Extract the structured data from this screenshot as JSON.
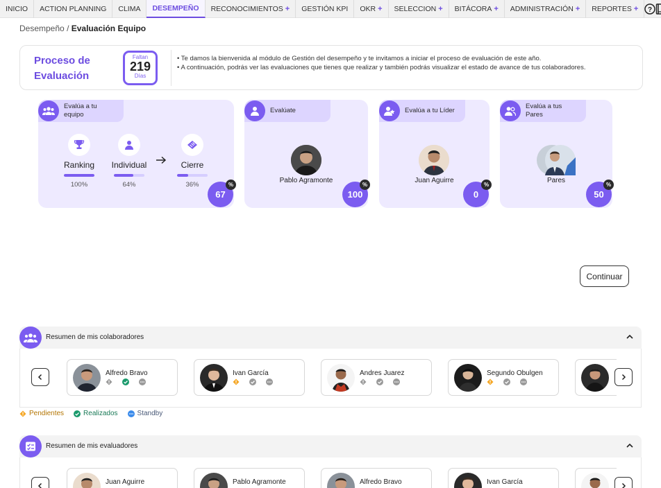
{
  "nav": {
    "items": [
      {
        "label": "INICIO",
        "plus": false,
        "active": false
      },
      {
        "label": "ACTION PLANNING",
        "plus": false,
        "active": false
      },
      {
        "label": "CLIMA",
        "plus": false,
        "active": false
      },
      {
        "label": "DESEMPEÑO",
        "plus": false,
        "active": true
      },
      {
        "label": "RECONOCIMIENTOS",
        "plus": true,
        "active": false
      },
      {
        "label": "GESTIÓN KPI",
        "plus": false,
        "active": false
      },
      {
        "label": "OKR",
        "plus": true,
        "active": false
      },
      {
        "label": "SELECCION",
        "plus": true,
        "active": false
      },
      {
        "label": "BITÁCORA",
        "plus": true,
        "active": false
      },
      {
        "label": "ADMINISTRACIÓN",
        "plus": true,
        "active": false
      },
      {
        "label": "REPORTES",
        "plus": true,
        "active": false
      }
    ],
    "plus_symbol": "+",
    "icons": [
      "help-icon",
      "book-icon"
    ]
  },
  "breadcrumb": {
    "parent": "Desempeño",
    "separator": "/",
    "current": "Evaluación Equipo"
  },
  "process": {
    "title": "Proceso de Evaluación",
    "countdown_label_top": "Faltan",
    "countdown_value": "219",
    "countdown_label_bottom": "Días",
    "line1": "• Te damos la bienvenida al módulo de Gestión del desempeño y te invitamos a iniciar el proceso de evaluación de este año.",
    "line2": "• A continuación, podrás ver las evaluaciones que tienes que realizar y también podrás visualizar el estado de avance de tus colaboradores."
  },
  "cards": {
    "team": {
      "title": "Evalúa a tu equipo",
      "percent": "67",
      "stages": [
        {
          "name": "Ranking",
          "value": "100%",
          "progress": 1.0
        },
        {
          "name": "Individual",
          "value": "64%",
          "progress": 0.64
        },
        {
          "name": "Cierre",
          "value": "36%",
          "progress": 0.36
        }
      ]
    },
    "self": {
      "title": "Evalúate",
      "person": "Pablo Agramonte",
      "percent": "100"
    },
    "leader": {
      "title": "Evalúa a tu Líder",
      "person": "Juan Aguirre",
      "percent": "0"
    },
    "peers": {
      "title": "Evalúa a tus Pares",
      "person": "Pares",
      "percent": "50"
    },
    "percent_symbol": "%"
  },
  "continue_label": "Continuar",
  "collaborators": {
    "title": "Resumen de mis colaboradores",
    "people": [
      {
        "name": "Alfredo Bravo",
        "statuses": [
          "standby-gray",
          "done",
          "standby"
        ]
      },
      {
        "name": "Ivan García",
        "statuses": [
          "pending",
          "done-gray",
          "standby"
        ]
      },
      {
        "name": "Andres Juarez",
        "statuses": [
          "standby-gray",
          "done-gray",
          "standby"
        ]
      },
      {
        "name": "Segundo Obulgen",
        "statuses": [
          "pending",
          "done-gray",
          "standby"
        ]
      }
    ]
  },
  "legend": {
    "pending": "Pendientes",
    "done": "Realizados",
    "standby": "Standby"
  },
  "evaluators": {
    "title": "Resumen de mis evaluadores",
    "people": [
      {
        "name": "Juan Aguirre"
      },
      {
        "name": "Pablo Agramonte"
      },
      {
        "name": "Alfredo Bravo"
      },
      {
        "name": "Ivan García"
      }
    ]
  },
  "colors": {
    "accent": "#7b5cf0",
    "accent_light": "#eeeaff",
    "pending": "#f5a623",
    "done": "#1a9a6c",
    "standby": "#3b8beb"
  }
}
